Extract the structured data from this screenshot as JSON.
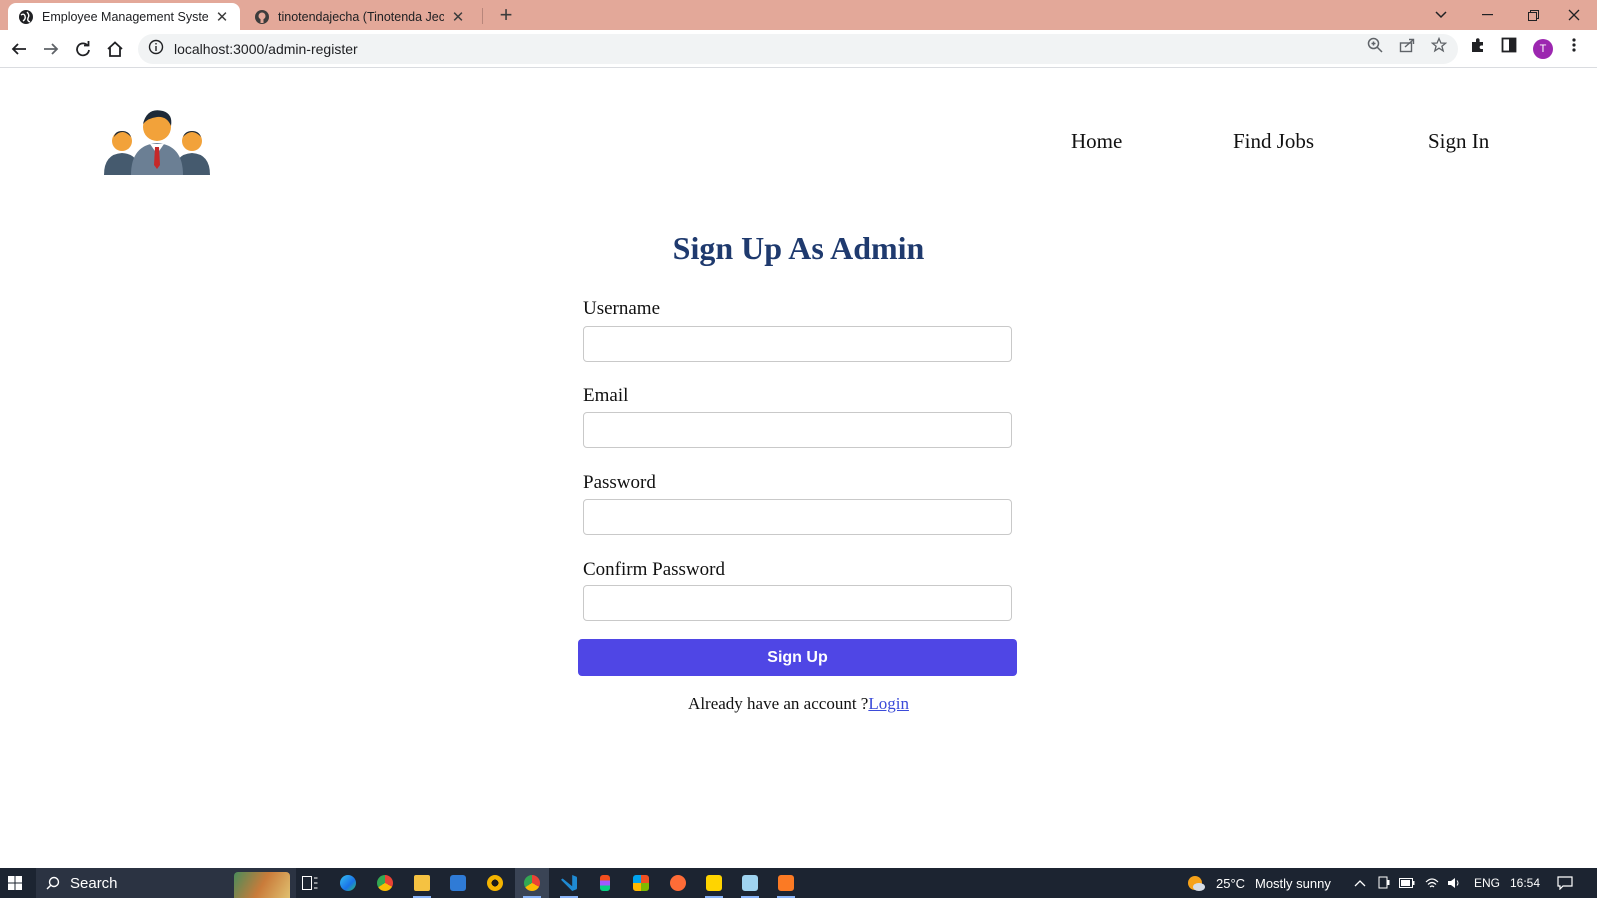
{
  "browser": {
    "tabs": [
      {
        "title": "Employee Management System",
        "active": true
      },
      {
        "title": "tinotendajecha (Tinotenda Jecha)",
        "active": false
      }
    ],
    "url": "localhost:3000/admin-register",
    "profile_initial": "T"
  },
  "nav": {
    "items": [
      "Home",
      "Find Jobs",
      "Sign In"
    ]
  },
  "form": {
    "title": "Sign Up As Admin",
    "fields": [
      {
        "label": "Username",
        "value": ""
      },
      {
        "label": "Email",
        "value": ""
      },
      {
        "label": "Password",
        "value": ""
      },
      {
        "label": "Confirm Password",
        "value": ""
      }
    ],
    "submit_label": "Sign Up",
    "account_prompt": "Already have an account ?",
    "login_link": "Login"
  },
  "taskbar": {
    "search_label": "Search",
    "weather_temp": "25°C",
    "weather_text": "Mostly sunny",
    "language": "ENG",
    "time": "16:54"
  },
  "colors": {
    "tab_strip": "#e3a899",
    "title_text": "#1f3a6e",
    "button": "#4f46e5",
    "link": "#3b4bd9",
    "taskbar": "#1c2431"
  }
}
